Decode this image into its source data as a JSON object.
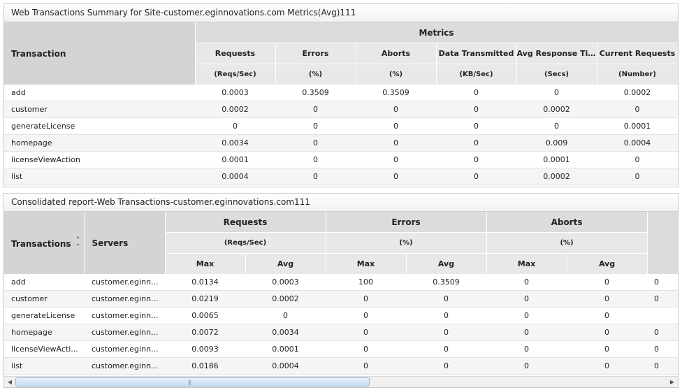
{
  "summary": {
    "title": "Web Transactions Summary for Site-customer.eginnovations.com Metrics(Avg)111",
    "transaction_header": "Transaction",
    "metrics_header": "Metrics",
    "columns": [
      {
        "label": "Requests",
        "unit": "(Reqs/Sec)"
      },
      {
        "label": "Errors",
        "unit": "(%)"
      },
      {
        "label": "Aborts",
        "unit": "(%)"
      },
      {
        "label": "Data Transmitted",
        "unit": "(KB/Sec)"
      },
      {
        "label": "Avg Response Time",
        "unit": "(Secs)"
      },
      {
        "label": "Current Requests",
        "unit": "(Number)"
      }
    ],
    "rows": [
      {
        "name": "add",
        "values": [
          "0.0003",
          "0.3509",
          "0.3509",
          "0",
          "0",
          "0.0002"
        ]
      },
      {
        "name": "customer",
        "values": [
          "0.0002",
          "0",
          "0",
          "0",
          "0.0002",
          "0"
        ]
      },
      {
        "name": "generateLicense",
        "values": [
          "0",
          "0",
          "0",
          "0",
          "0",
          "0.0001"
        ]
      },
      {
        "name": "homepage",
        "values": [
          "0.0034",
          "0",
          "0",
          "0",
          "0.009",
          "0.0004"
        ]
      },
      {
        "name": "licenseViewAction",
        "values": [
          "0.0001",
          "0",
          "0",
          "0",
          "0.0001",
          "0"
        ]
      },
      {
        "name": "list",
        "values": [
          "0.0004",
          "0",
          "0",
          "0",
          "0.0002",
          "0"
        ]
      }
    ]
  },
  "consolidated": {
    "title": "Consolidated report-Web Transactions-customer.eginnovations.com111",
    "transactions_header": "Transactions",
    "servers_header": "Servers",
    "groups": [
      {
        "label": "Requests",
        "unit": "(Reqs/Sec)"
      },
      {
        "label": "Errors",
        "unit": "(%)"
      },
      {
        "label": "Aborts",
        "unit": "(%)"
      }
    ],
    "max_label": "Max",
    "avg_label": "Avg",
    "rows": [
      {
        "name": "add",
        "server": "customer.eginn...",
        "values": [
          "0.0134",
          "0.0003",
          "100",
          "0.3509",
          "0",
          "0"
        ],
        "extra": "0"
      },
      {
        "name": "customer",
        "server": "customer.eginn...",
        "values": [
          "0.0219",
          "0.0002",
          "0",
          "0",
          "0",
          "0"
        ],
        "extra": "0"
      },
      {
        "name": "generateLicense",
        "server": "customer.eginn...",
        "values": [
          "0.0065",
          "0",
          "0",
          "0",
          "0",
          "0"
        ],
        "extra": ""
      },
      {
        "name": "homepage",
        "server": "customer.eginn...",
        "values": [
          "0.0072",
          "0.0034",
          "0",
          "0",
          "0",
          "0"
        ],
        "extra": "0"
      },
      {
        "name": "licenseViewActi...",
        "server": "customer.eginn...",
        "values": [
          "0.0093",
          "0.0001",
          "0",
          "0",
          "0",
          "0"
        ],
        "extra": "0"
      },
      {
        "name": "list",
        "server": "customer.eginn...",
        "values": [
          "0.0186",
          "0.0004",
          "0",
          "0",
          "0",
          "0"
        ],
        "extra": "0"
      }
    ]
  }
}
